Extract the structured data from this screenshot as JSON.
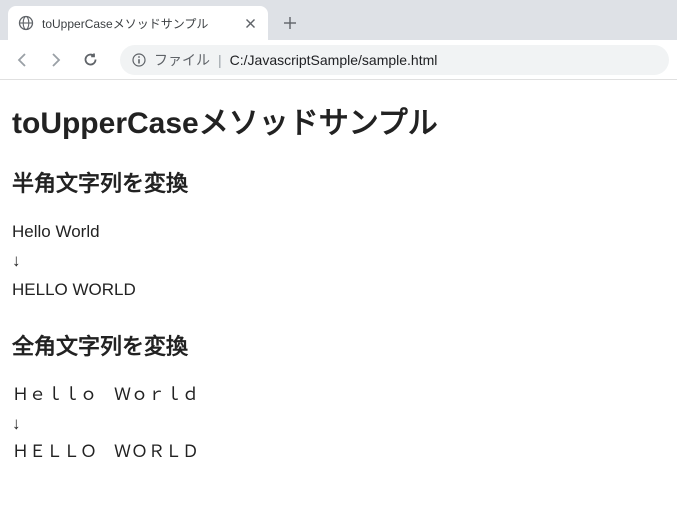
{
  "browser": {
    "tab": {
      "title": "toUpperCaseメソッドサンプル"
    },
    "address": {
      "prefix": "ファイル",
      "separator": "|",
      "path": "C:/JavascriptSample/sample.html"
    }
  },
  "page": {
    "heading": "toUpperCaseメソッドサンプル",
    "sections": [
      {
        "title": "半角文字列を変換",
        "input": "Hello World",
        "arrow": "↓",
        "output": "HELLO WORLD"
      },
      {
        "title": "全角文字列を変換",
        "input": "Ｈｅｌｌｏ　Ｗｏｒｌｄ",
        "arrow": "↓",
        "output": "ＨＥＬＬＯ　ＷＯＲＬＤ"
      }
    ]
  }
}
